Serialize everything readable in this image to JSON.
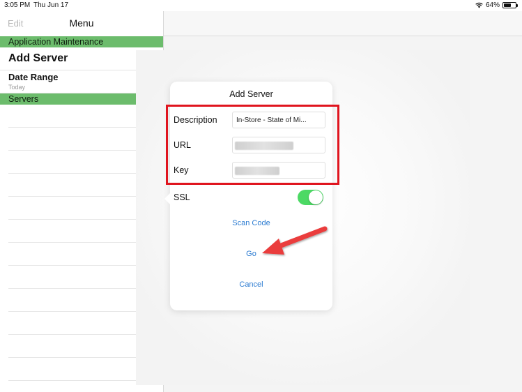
{
  "status_bar": {
    "time": "3:05 PM",
    "date": "Thu Jun 17",
    "battery": "64%",
    "battery_level": 0.64
  },
  "sidebar": {
    "edit_label": "Edit",
    "title": "Menu",
    "section_app": "Application Maintenance",
    "add_server": "Add Server",
    "date_range": {
      "label": "Date Range",
      "value": "Today"
    },
    "section_servers": "Servers"
  },
  "popover": {
    "title": "Add Server",
    "description": {
      "label": "Description",
      "value": "In-Store - State of Mi..."
    },
    "url": {
      "label": "URL",
      "value": ""
    },
    "key": {
      "label": "Key",
      "value": ""
    },
    "ssl": {
      "label": "SSL",
      "on": true
    },
    "scan_code": "Scan Code",
    "go": "Go",
    "cancel": "Cancel"
  },
  "colors": {
    "section_green": "#6cbc6c",
    "link_blue": "#2b7bd1",
    "toggle_green": "#4cd964",
    "annotation_red": "#e0141e"
  },
  "icons": [
    "wifi-icon",
    "battery-icon",
    "chevron-right-icon",
    "arrow-annotation"
  ]
}
